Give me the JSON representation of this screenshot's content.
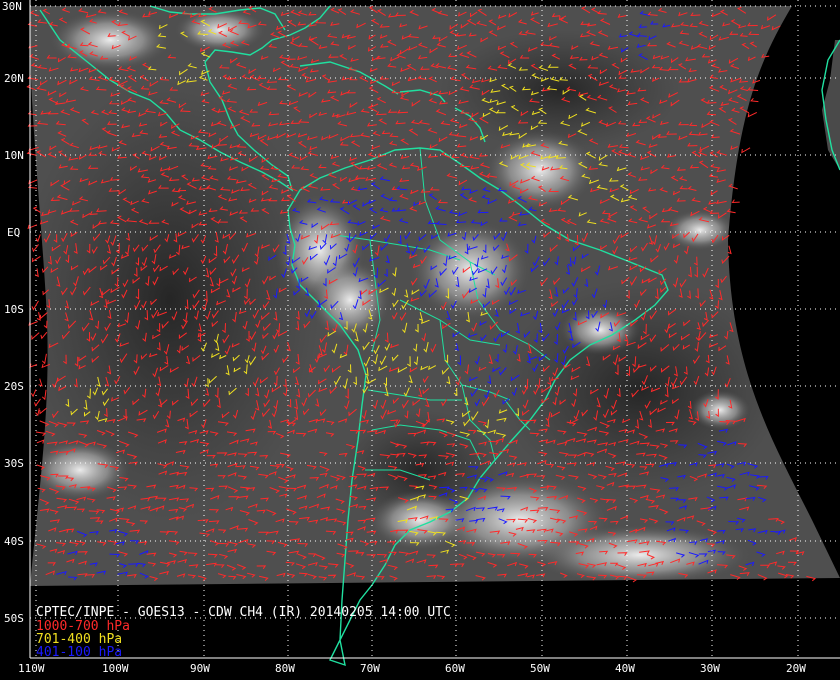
{
  "caption": "CPTEC/INPE - GOES13 - CDW CH4 (IR) 20140205 14:00 UTC",
  "legend": [
    {
      "label": "1000-700 hPa",
      "color": "#ff2a2a"
    },
    {
      "label": "701-400 hPa",
      "color": "#f0e020"
    },
    {
      "label": "401-100 hPa",
      "color": "#1a1aff"
    }
  ],
  "colors": {
    "coastline": "#20e0a0",
    "grid": "#ffffff",
    "space": "#000000"
  },
  "latitudes": [
    "30N",
    "20N",
    "10N",
    "EQ",
    "10S",
    "20S",
    "30S",
    "40S",
    "50S"
  ],
  "longitudes": [
    "110W",
    "100W",
    "90W",
    "80W",
    "70W",
    "60W",
    "50W",
    "40W",
    "30W",
    "20W"
  ]
}
